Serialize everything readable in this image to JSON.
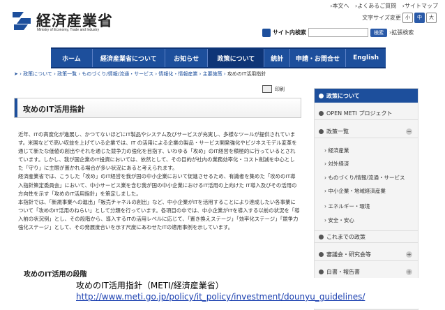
{
  "header": {
    "logo_jp": "経済産業省",
    "logo_en": "Ministry of Economy, Trade and Industry",
    "utility_links": [
      "›本文へ",
      "›よくあるご質問",
      "›サイトマップ"
    ],
    "font_size_label": "文字サイズ変更",
    "font_sizes": [
      "小",
      "中",
      "大"
    ],
    "search_label": "サイト内検索",
    "search_button": "検索",
    "advanced_search": "›拡張検索"
  },
  "nav": [
    "ホーム",
    "経済産業省について",
    "お知らせ",
    "政策について",
    "統計",
    "申請・お問合せ",
    "English"
  ],
  "breadcrumb": [
    "政策について",
    "政策一覧",
    "ものづくり/情報/流通・サービス",
    "情報化・情報産業",
    "主要施策",
    "攻めのIT活用指針"
  ],
  "print_label": "印刷",
  "page_title": "攻めのIT活用指針",
  "body_paragraphs": [
    "近年、ITの高度化が進展し、かつてないほどにIT製品やシステム及びサービスが充実し、多様なツールが提供されています。米国などで高い収益を上げている企業では、IT の活用による企業の製品・サービス開発強化やビジネスモデル変革を通じて新たな価値の創出やそれを通じた競争力の強化を目指す、いわゆる「攻め」のIT経営を積極的に行っているとされています。しかし、我が国企業のIT投資においては、依然として、その目的が社内の業務効率化・コスト削減を中心とした「守り」に主眼が置かれる場合が多い状況にあると考えられます。",
    "経済産業省では、こうした「攻め」のIT経営を我が国の中小企業において促進させるため、有識者を集めた「攻めのIT導入指針策定委員会」において、中小サービス業を含む我が国の中小企業におけるIT活用の上向けた IT導入及びその活用の方向性を示す「攻めのIT活用指針」を策定しました。",
    "本指針では、「新規事業への進出」「販売チャネルの創出」など、中小企業がITを活用することにより達成したい各事業について「攻めのIT活用のねらい」として分類を行っています。各項目の中では、中小企業がITを導入する以前の状況を「導入前の状況例」とし、その段階から、導入するITの活用レベルに応じて、「置き換えステージ」「効率化ステージ」「競争力強化ステージ」として、その発展度合いを示す尺度にあわせたITの適用事例を示しています。"
  ],
  "sub_heading": "攻めのIT活用の段階",
  "sidebar": {
    "header": "政策について",
    "top_items": [
      "OPEN METI プロジェクト",
      "政策一覧"
    ],
    "sub_items": [
      "経済産業",
      "対外経済",
      "ものづくり/情報/流通・サービス",
      "中小企業・地域経済産業",
      "エネルギー・環境",
      "安全・安心"
    ],
    "bottom_items": [
      "これまでの政策",
      "審議会・研究会等",
      "白書・報告書"
    ]
  },
  "caption": {
    "line1": "攻めのIT活用指針（METI/経済産業省）",
    "url": "http://www.meti.go.jp/policy/it_policy/investment/dounyu_guidelines/"
  },
  "colors": {
    "brand": "#1d4f9c",
    "link": "#1a3fb0"
  }
}
